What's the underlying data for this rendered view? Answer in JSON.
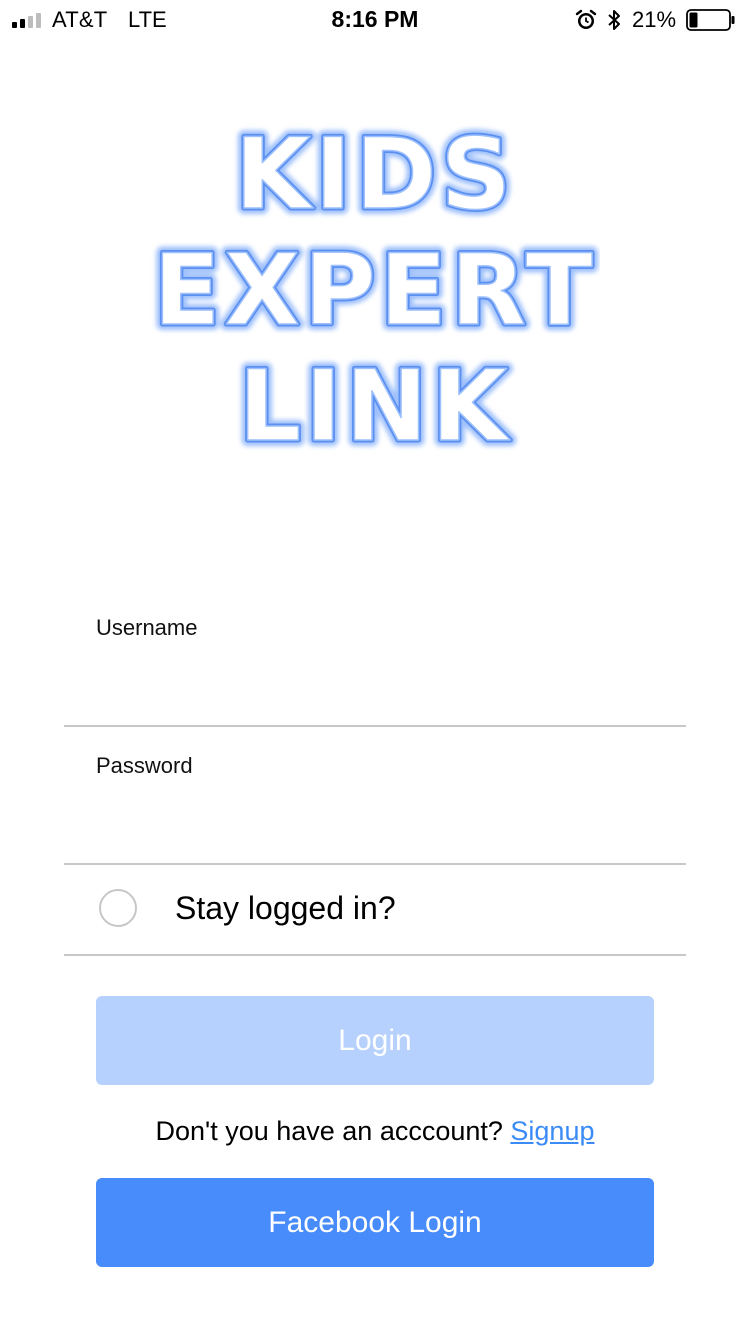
{
  "status_bar": {
    "carrier": "AT&T",
    "network": "LTE",
    "time": "8:16 PM",
    "battery_percent": "21%",
    "battery_level": 0.21,
    "signal_strength": 2,
    "signal_total": 4,
    "icons": [
      "signal-icon",
      "alarm-icon",
      "bluetooth-icon",
      "battery-icon"
    ]
  },
  "logo": {
    "lines": [
      "KIDS",
      "EXPERT",
      "LINK"
    ],
    "colors": {
      "stroke": "#5b8ff0",
      "glow": "#9ec0fb",
      "fill": "#ffffff"
    }
  },
  "form": {
    "username_label": "Username",
    "username_value": "",
    "password_label": "Password",
    "password_value": "",
    "stay_logged_in_label": "Stay logged in?",
    "stay_logged_in_checked": false,
    "login_label": "Login",
    "login_enabled": false,
    "signup_prompt": "Don't you have an acccount?",
    "signup_link": "Signup",
    "facebook_login_label": "Facebook Login"
  },
  "colors": {
    "login_disabled_bg": "#b6d1fd",
    "facebook_bg": "#488bfb",
    "link": "#3b8bf7",
    "divider": "#c8c8c8"
  }
}
